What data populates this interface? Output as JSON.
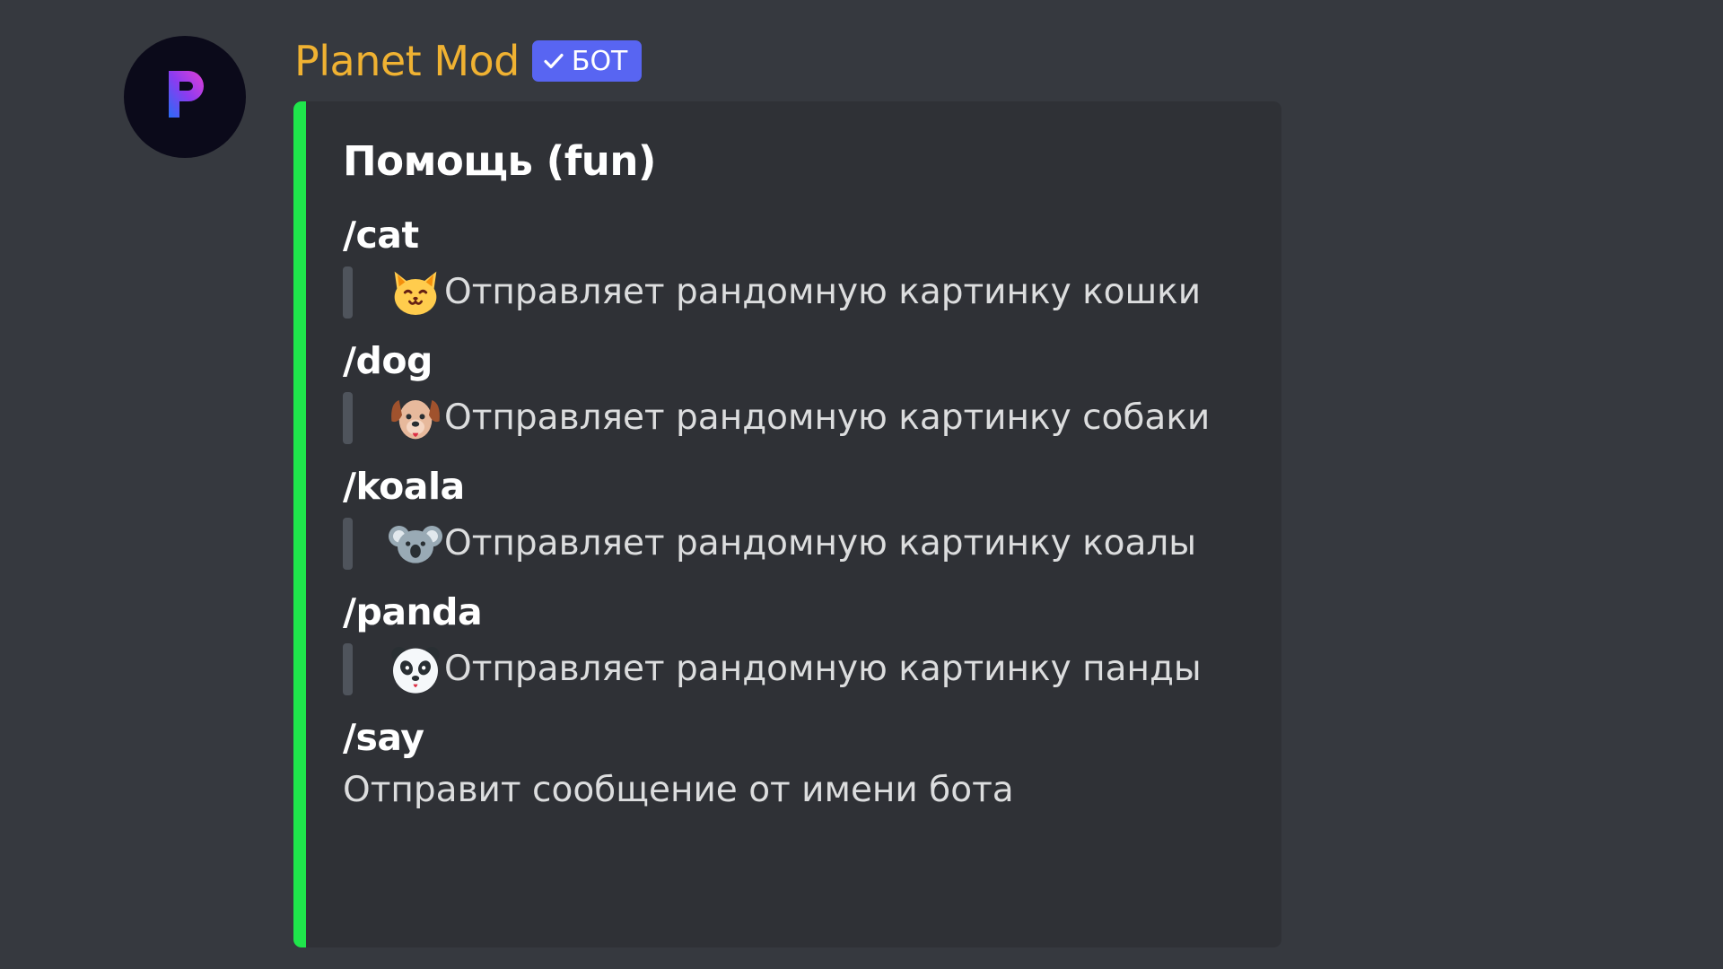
{
  "message": {
    "author": "Planet Mod",
    "bot_tag": "БОТ",
    "avatar_icon": "planet-mod-logo-icon"
  },
  "colors": {
    "background": "#36393f",
    "embed_background": "#2f3136",
    "embed_accent": "#1fe54b",
    "username": "#f0b232",
    "bot_tag": "#5865f2"
  },
  "embed": {
    "title": "Помощь (fun)",
    "fields": [
      {
        "name": "/cat",
        "icon": "cat-face-icon",
        "value": "Отправляет рандомную картинку кошки"
      },
      {
        "name": "/dog",
        "icon": "dog-face-icon",
        "value": "Отправляет рандомную картинку собаки"
      },
      {
        "name": "/koala",
        "icon": "koala-icon",
        "value": "Отправляет рандомную картинку коалы"
      },
      {
        "name": "/panda",
        "icon": "panda-face-icon",
        "value": "Отправляет рандомную картинку панды"
      },
      {
        "name": "/say",
        "value": "Отправит сообщение от имени бота"
      }
    ]
  }
}
